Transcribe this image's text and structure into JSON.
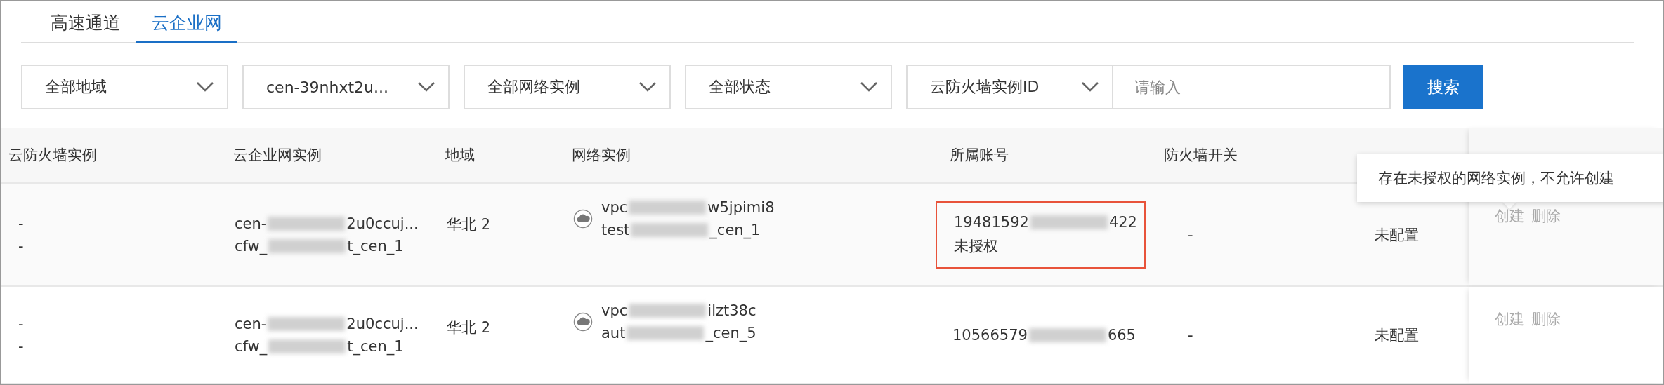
{
  "tabs": [
    {
      "label": "高速通道",
      "selected": false
    },
    {
      "label": "云企业网",
      "selected": true
    }
  ],
  "filters": {
    "selects": [
      {
        "value": "全部地域"
      },
      {
        "value": "cen-39nhxt2u..."
      },
      {
        "value": "全部网络实例"
      },
      {
        "value": "全部状态"
      },
      {
        "value": "云防火墙实例ID"
      }
    ],
    "search": {
      "placeholder": "请输入"
    },
    "button": "搜索"
  },
  "table": {
    "columns": [
      "云防火墙实例",
      "云企业网实例",
      "地域",
      "网络实例",
      "所属账号",
      "防火墙开关"
    ],
    "rows": [
      {
        "firewall": [
          "-",
          "-"
        ],
        "cen": [
          {
            "before": "cen-",
            "after": "2u0ccuj..."
          },
          {
            "before": "cfw_",
            "after": "t_cen_1"
          }
        ],
        "region": "华北 2",
        "network": [
          {
            "before": "vpc",
            "after": "w5jpimi8"
          },
          {
            "before": "test",
            "after": "_cen_1"
          }
        ],
        "account": {
          "before": "19481592",
          "after": "422",
          "note": "未授权",
          "highlighted": true
        },
        "switch": "-",
        "status": "未配置",
        "actions": [
          {
            "label": "创建",
            "disabled": true
          },
          {
            "label": "删除",
            "disabled": true
          }
        ]
      },
      {
        "firewall": [
          "-",
          "-"
        ],
        "cen": [
          {
            "before": "cen-",
            "after": "2u0ccuj..."
          },
          {
            "before": "cfw_",
            "after": "t_cen_1"
          }
        ],
        "region": "华北 2",
        "network": [
          {
            "before": "vpc",
            "after": "ilzt38c"
          },
          {
            "before": "aut",
            "after": "_cen_5"
          }
        ],
        "account": {
          "before": "10566579",
          "after": "665",
          "highlighted": false
        },
        "switch": "-",
        "status": "未配置",
        "actions": [
          {
            "label": "创建",
            "disabled": true
          },
          {
            "label": "删除",
            "disabled": true
          }
        ]
      }
    ]
  },
  "tooltip": "存在未授权的网络实例，不允许创建"
}
